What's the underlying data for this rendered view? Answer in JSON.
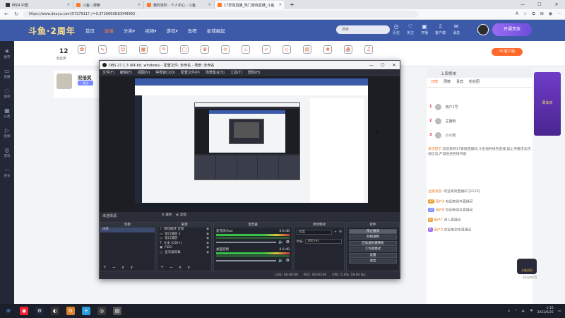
{
  "browser": {
    "tabs": [
      {
        "title": "MSN 中国"
      },
      {
        "title": "斗鱼 - 搜索"
      },
      {
        "title": "我的资料 - 个人中心 - 斗鱼"
      },
      {
        "title": "17爱情直播_热门游戏直播_斗鱼"
      }
    ],
    "url": "https://www.douyu.com/5727911?_r=0.3726660810049983",
    "new_tab": "+",
    "controls": {
      "min": "—",
      "max": "☐",
      "close": "✕"
    }
  },
  "douyu": {
    "logo": "斗鱼·2周年",
    "nav": [
      "首页",
      "直播",
      "分类▾",
      "视频▾",
      "游戏▾",
      "鱼吧",
      "星域崛起"
    ],
    "nav_active": 1,
    "search_placeholder": "搜索",
    "tools": [
      "历史",
      "关注",
      "开播",
      "客户端",
      "消息"
    ],
    "vip": "开通贵族",
    "sidebar": [
      "推荐",
      "直播",
      "鱼吧",
      "分类",
      "视频",
      "游戏",
      "更多"
    ],
    "level": "12",
    "level_sub": "粉丝牌",
    "pc_button": "PC客户端",
    "streamer_name": "双倍奖",
    "streamer_tag": "关注",
    "right": {
      "top": "上周榜单",
      "tabs": [
        "日榜",
        "周榜",
        "贵宾",
        "粉丝团"
      ],
      "ranks": [
        {
          "n": "1",
          "name": "用户1号"
        },
        {
          "n": "2",
          "name": "主播粉"
        },
        {
          "n": "3",
          "name": "小火箭"
        }
      ],
      "chat": [
        {
          "user": "系统提示:",
          "text": "欢迎来到17爱情直播间,斗鱼倡导绿色直播,禁止传播违法违规信息,严禁低俗色情内容"
        },
        {
          "user": "主播消息:",
          "text": "欢迎来到直播间 [1110]"
        },
        {
          "user": "用户A",
          "text": "欢迎来到本直播间"
        },
        {
          "user": "用户B",
          "text": "欢迎来到本直播间"
        },
        {
          "user": "用户C",
          "text": "进入直播间"
        },
        {
          "user": "用户D",
          "text": "欢迎来到本直播间"
        }
      ]
    },
    "ad_text": "周年庆",
    "lower_badge": "斗鱼百科",
    "timestamp": "2022/6/25"
  },
  "obs": {
    "title": "OBS 27.1.3 (64-bit, windows) - 配置文件: 未命名 - 场景: 未命名",
    "menu": [
      "文件(F)",
      "编辑(E)",
      "视图(V)",
      "停靠窗口(D)",
      "配置文件(P)",
      "场景集合(S)",
      "工具(T)",
      "帮助(H)"
    ],
    "scene_bar": "未选择源",
    "src_props": [
      "属性",
      "滤镜"
    ],
    "docks": {
      "scenes": {
        "title": "场景",
        "items": [
          "场景"
        ]
      },
      "sources": {
        "title": "来源",
        "items": [
          "游戏捕获 音频",
          "窗口捕获 2",
          "窗口捕获",
          "文本 (GDI+)",
          "FIBO",
          "显示器采集"
        ]
      },
      "mixer": {
        "title": "混音器",
        "ch1": "麦克风/Aux",
        "ch1_db": "0.0 dB",
        "ch2": "桌面音频",
        "ch2_db": "0.0 dB"
      },
      "transitions": {
        "title": "转场特效",
        "type": "淡出",
        "duration_label": "时长",
        "duration": "300 ms"
      },
      "controls": {
        "title": "控件",
        "buttons": [
          "停止推流",
          "开始录制",
          "启动虚拟摄像机",
          "工作室模式",
          "设置",
          "退出"
        ]
      }
    },
    "foot": "+ − ∧ ∨",
    "status": [
      "LIVE: 00:00:00",
      "REC: 00:00:00",
      "CPU: 5.0%, 59.94 fps"
    ]
  },
  "taskbar": {
    "clock": "1:15",
    "date": "2022/6/25",
    "ime": "中"
  },
  "colors": {
    "douyu_blue": "#3c5aa8",
    "douyu_orange": "#ff6a2a",
    "obs_dark": "#2b2e38"
  }
}
